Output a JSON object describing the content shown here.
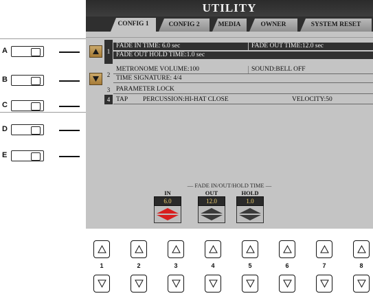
{
  "screen": {
    "title": "UTILITY",
    "tabs": [
      {
        "label": "CONFIG 1",
        "active": true
      },
      {
        "label": "CONFIG 2",
        "active": false
      },
      {
        "label": "MEDIA",
        "active": false
      },
      {
        "label": "OWNER",
        "active": false
      },
      {
        "label": "SYSTEM RESET",
        "active": false
      }
    ],
    "row_numbers": [
      "1",
      "2",
      "3",
      "4"
    ],
    "params": {
      "fade_in_time": "FADE IN TIME:  6.0 sec",
      "fade_out_time": "FADE OUT TIME:12.0 sec",
      "fade_out_hold_time": "FADE OUT HOLD TIME:1.0 sec",
      "metronome_volume": "METRONOME VOLUME:100",
      "sound": "SOUND:BELL OFF",
      "time_signature": "TIME SIGNATURE:   4/4",
      "parameter_lock": "PARAMETER LOCK",
      "tap": "TAP",
      "percussion": "PERCUSSION:HI-HAT CLOSE",
      "velocity": "VELOCITY:50"
    },
    "fade_panel": {
      "label": "FADE IN/OUT/HOLD TIME",
      "knobs": [
        {
          "head": "IN",
          "value": "6.0",
          "highlighted": true
        },
        {
          "head": "OUT",
          "value": "12.0",
          "highlighted": false
        },
        {
          "head": "HOLD",
          "value": "1.0",
          "highlighted": false
        }
      ]
    },
    "colors": {
      "lcd_bg": "#c4c4c4",
      "selected_row": "#303030",
      "highlight_red": "#d81e1e",
      "value_text": "#f0d070"
    }
  },
  "left_buttons": [
    "A",
    "B",
    "C",
    "D",
    "E"
  ],
  "bottom_buttons": [
    "1",
    "2",
    "3",
    "4",
    "5",
    "6",
    "7",
    "8"
  ]
}
